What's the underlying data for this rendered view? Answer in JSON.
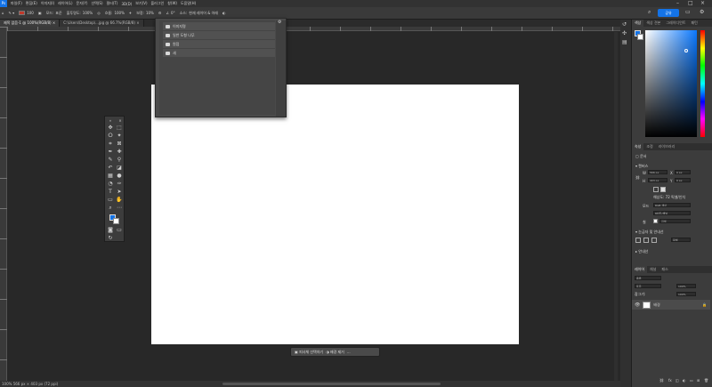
{
  "menubar": {
    "items": [
      "파일(F)",
      "편집(E)",
      "이미지(I)",
      "레이어(L)",
      "문자(Y)",
      "선택(S)",
      "필터(T)",
      "3D(D)",
      "보기(V)",
      "플러그인",
      "창(W)",
      "도움말(H)"
    ]
  },
  "options": {
    "brush_size": "100",
    "mode_label": "모드:",
    "mode_value": "표준",
    "opacity_label": "불투명도:",
    "opacity_value": "100%",
    "flow_label": "흐름:",
    "flow_value": "100%",
    "smoothing_label": "보정:",
    "smoothing_value": "10%",
    "angle_value": "0°",
    "source_label": "소스:",
    "source_value": "현재 레이어 & 아래",
    "share_label": "공유"
  },
  "tabs": [
    {
      "label": "제목 없음-1 @ 100%(RGB/8) ×"
    },
    {
      "label": "C:\\Users\\Desktop\\...jpg @ 66.7%(RGB/8) ×"
    }
  ],
  "dropdown": {
    "items": [
      {
        "label": "이미지명"
      },
      {
        "label": "일반 도형 나무"
      },
      {
        "label": "원점"
      },
      {
        "label": "새"
      }
    ]
  },
  "colors": {
    "foreground": "#1473e6",
    "background": "#ffffff"
  },
  "ctxbar": {
    "select_subject": "피사체 선택하기",
    "remove_bg": "배경 제거",
    "more": "..."
  },
  "status": {
    "zoom_info": "100%  566 px × 403 px (72 ppi)"
  },
  "panels": {
    "color_tabs": [
      "색상",
      "색상 견본",
      "그레이디언트",
      "패턴"
    ],
    "props_tabs": [
      "속성",
      "조정",
      "라이브러리"
    ],
    "doc_label": "문서",
    "canvas_section": "캔버스",
    "width_value": "566 px",
    "height_value": "403 px",
    "x_value": "0 px",
    "y_value": "0 px",
    "resolution": "해상도: 72 픽셀/인치",
    "mode_label": "모드",
    "mode_value": "RGB 색상",
    "depth_value": "8비트/채널",
    "fill_label": "칠",
    "fill_value": "흰색",
    "ruler_section": "눈금자 및 안내선",
    "ruler_unit": "픽셀",
    "guides_section": "안내선",
    "layers_tabs": [
      "레이어",
      "채널",
      "패스"
    ],
    "layer_search": "종류",
    "blend_mode": "표준",
    "opacity_value": "100%",
    "lock_label": "잠그기:",
    "fill_value2": "100%",
    "layer_name": "배경"
  }
}
